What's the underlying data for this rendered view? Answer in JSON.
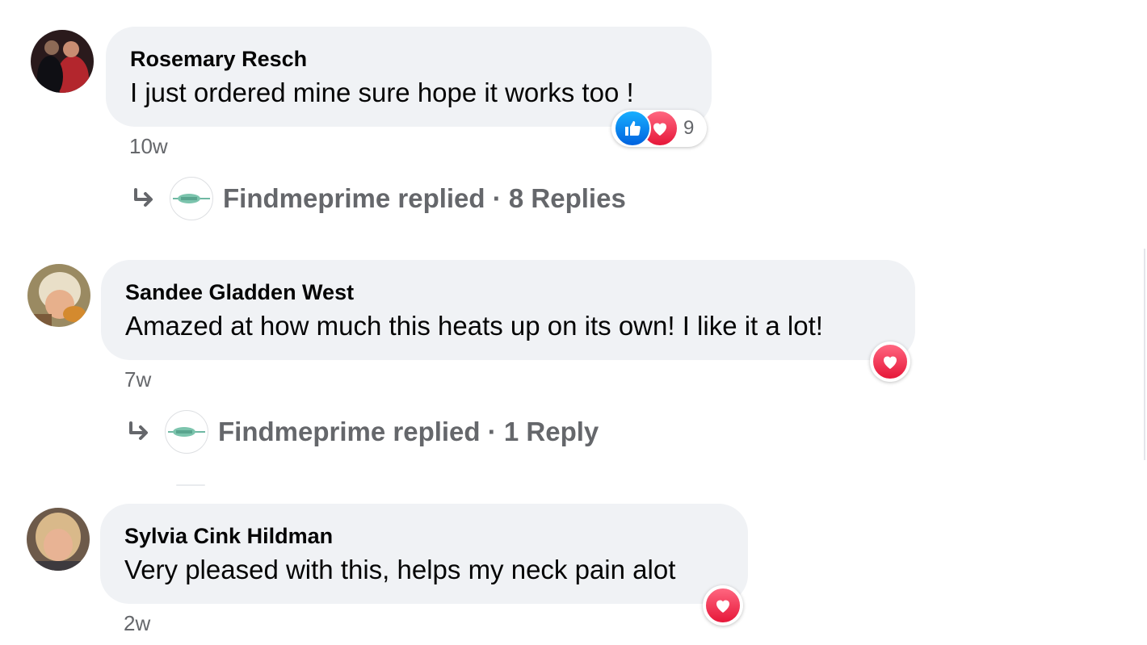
{
  "comments": [
    {
      "author": "Rosemary Resch",
      "text": "I just ordered mine sure hope it works too !",
      "time": "10w",
      "reactions": [
        "like-icon",
        "love-icon"
      ],
      "reaction_count": "9",
      "reply": {
        "text": "Findmeprime replied · 8 Replies"
      }
    },
    {
      "author": "Sandee Gladden West",
      "text": "Amazed at how much this heats up on its own! I like it a lot!",
      "time": "7w",
      "reactions": [
        "love-icon"
      ],
      "reply": {
        "text": "Findmeprime replied · 1 Reply"
      }
    },
    {
      "author": "Sylvia Cink Hildman",
      "text": "Very pleased with this, helps my neck pain alot",
      "time": "2w",
      "reactions": [
        "love-icon"
      ]
    }
  ],
  "colors": {
    "bubble": "#f0f2f5",
    "muted_text": "#65676b",
    "like_blue": "#1877f2",
    "love_red": "#f33e58"
  }
}
